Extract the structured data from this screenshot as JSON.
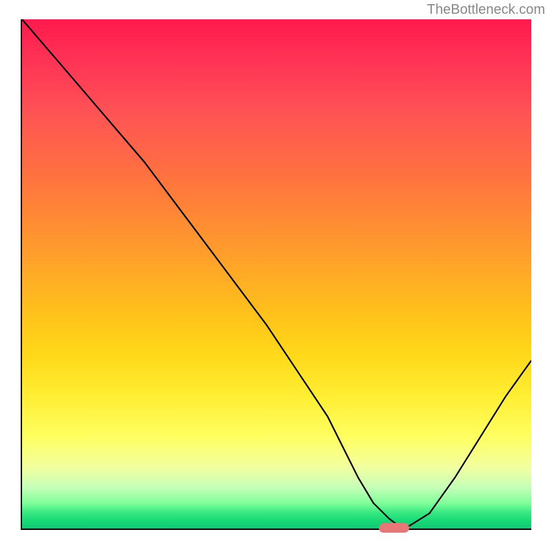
{
  "watermark": "TheBottleneck.com",
  "chart_data": {
    "type": "line",
    "x": [
      0,
      6,
      12,
      18,
      24,
      30,
      36,
      42,
      48,
      54,
      60,
      63,
      66,
      69,
      72,
      74,
      76,
      80,
      85,
      90,
      95,
      100
    ],
    "values": [
      100,
      93,
      86,
      79,
      72,
      64,
      56,
      48,
      40,
      31,
      22,
      16,
      10,
      5,
      2,
      0.5,
      0.5,
      3,
      10,
      18,
      26,
      33
    ],
    "title": "",
    "xlabel": "",
    "ylabel": "",
    "xlim": [
      0,
      100
    ],
    "ylim": [
      0,
      100
    ],
    "marker_x_range": [
      70,
      76
    ],
    "marker_y": 0,
    "annotations": [
      "TheBottleneck.com"
    ]
  }
}
